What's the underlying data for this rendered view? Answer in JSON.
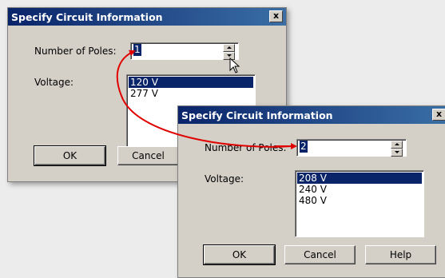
{
  "dialog1": {
    "title": "Specify Circuit Information",
    "close_label": "x",
    "poles_label": "Number of Poles:",
    "poles_value": "1",
    "voltage_label": "Voltage:",
    "voltage_options": [
      "120 V",
      "277 V"
    ],
    "ok_label": "OK",
    "cancel_label": "Cancel"
  },
  "dialog2": {
    "title": "Specify Circuit Information",
    "close_label": "x",
    "poles_label": "Number of Poles:",
    "poles_value": "2",
    "voltage_label": "Voltage:",
    "voltage_options": [
      "208 V",
      "240 V",
      "480 V"
    ],
    "ok_label": "OK",
    "cancel_label": "Cancel",
    "help_label": "Help"
  },
  "annotation_color": "#e00000"
}
